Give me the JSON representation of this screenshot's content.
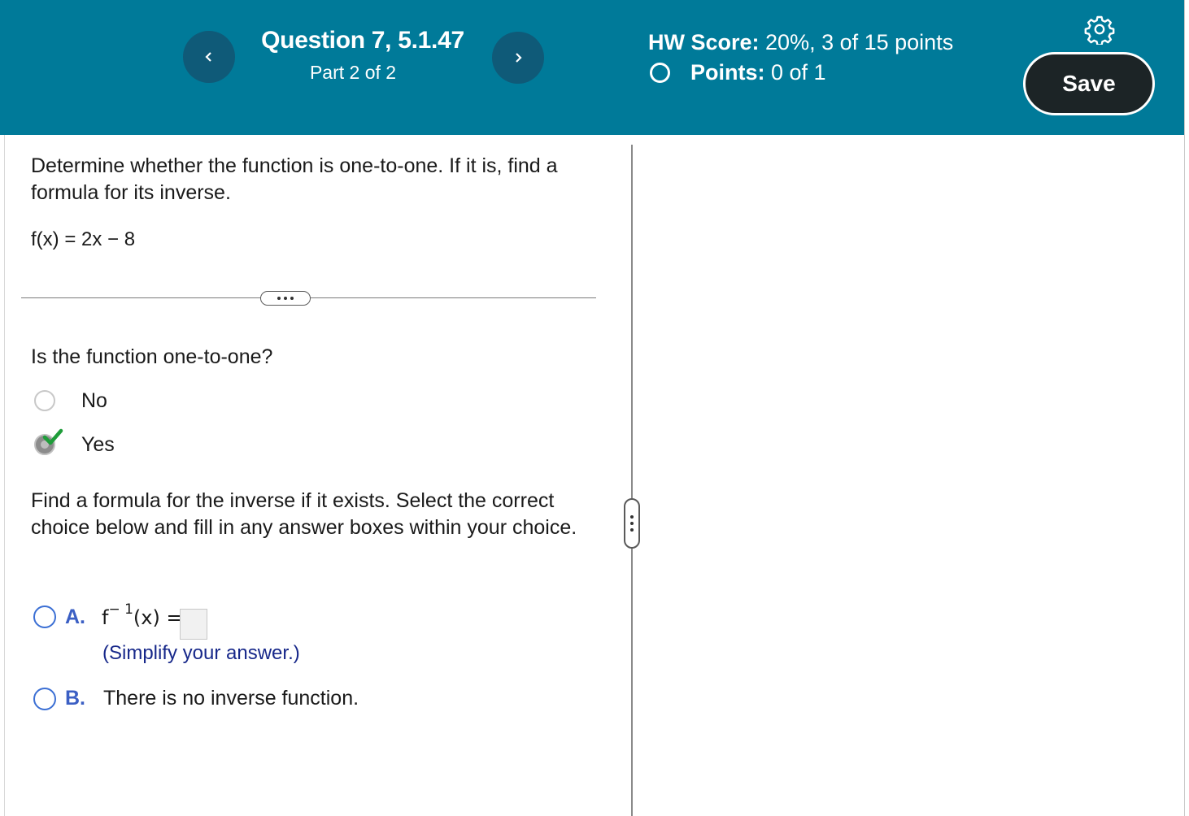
{
  "header": {
    "question_title": "Question 7, 5.1.47",
    "part": "Part 2 of 2",
    "hw_score_label": "HW Score:",
    "hw_score_value": " 20%, 3 of 15 points",
    "points_label": "Points:",
    "points_value": " 0 of 1",
    "save_label": "Save",
    "prev_icon": "chevron-left-icon",
    "next_icon": "chevron-right-icon",
    "settings_icon": "gear-icon"
  },
  "problem": {
    "prompt": "Determine whether the function is one-to-one. If it is, find a formula for its inverse.",
    "function": "f(x) = 2x − 8"
  },
  "part1": {
    "question": "Is the function one-to-one?",
    "options": [
      {
        "label": "No",
        "selected": false
      },
      {
        "label": "Yes",
        "selected": true,
        "marked_correct": true
      }
    ]
  },
  "part2": {
    "instructions": "Find a formula for the inverse if it exists. Select the correct choice below and fill in any answer boxes within your choice.",
    "choice_a": {
      "letter": "A.",
      "math_base": "f",
      "math_exp": "− 1",
      "math_rest": "(x) =",
      "hint": "(Simplify your answer.)",
      "answer": ""
    },
    "choice_b": {
      "letter": "B.",
      "text": "There is no inverse function."
    }
  },
  "colors": {
    "header_bg": "#007a99",
    "nav_button": "#0f5a78",
    "save_button": "#1c2426",
    "choice_letter": "#3b5fc4",
    "hint_text": "#17288a",
    "check": "#1f9d3a"
  }
}
